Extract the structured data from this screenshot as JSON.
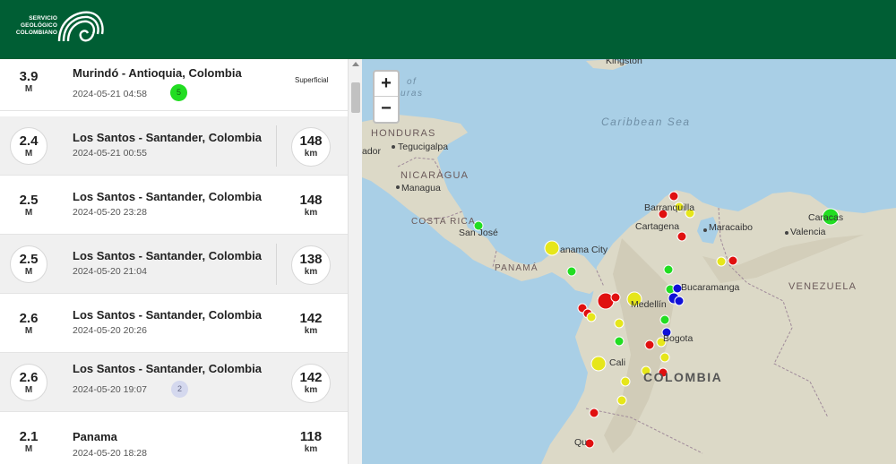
{
  "header": {
    "logo_lines": [
      "SERVICIO",
      "GEOLÓGICO",
      "COLOMBIANO"
    ],
    "brand_color": "#005e34"
  },
  "events": [
    {
      "mag": "3.9",
      "mag_unit": "M",
      "place": "Murindó - Antioquia, Colombia",
      "time": "2024-05-21 04:58",
      "depth_label": "Superficial",
      "badge": "5",
      "badge_color": "green"
    },
    {
      "mag": "2.4",
      "mag_unit": "M",
      "place": "Los Santos - Santander, Colombia",
      "time": "2024-05-21 00:55",
      "depth": "148",
      "depth_unit": "km"
    },
    {
      "mag": "2.5",
      "mag_unit": "M",
      "place": "Los Santos - Santander, Colombia",
      "time": "2024-05-20 23:28",
      "depth": "148",
      "depth_unit": "km"
    },
    {
      "mag": "2.5",
      "mag_unit": "M",
      "place": "Los Santos - Santander, Colombia",
      "time": "2024-05-20 21:04",
      "depth": "138",
      "depth_unit": "km"
    },
    {
      "mag": "2.6",
      "mag_unit": "M",
      "place": "Los Santos - Santander, Colombia",
      "time": "2024-05-20 20:26",
      "depth": "142",
      "depth_unit": "km"
    },
    {
      "mag": "2.6",
      "mag_unit": "M",
      "place": "Los Santos - Santander, Colombia",
      "time": "2024-05-20 19:07",
      "depth": "142",
      "depth_unit": "km",
      "badge": "2",
      "badge_color": "grey"
    },
    {
      "mag": "2.1",
      "mag_unit": "M",
      "place": "Panama",
      "time": "2024-05-20 18:28",
      "depth": "118",
      "depth_unit": "km"
    }
  ],
  "map": {
    "zoom_in": "+",
    "zoom_out": "−",
    "labels": {
      "kingston": "Kingston",
      "caribbean": "Caribbean Sea",
      "of": "of",
      "uras": "uras",
      "honduras": "HONDURAS",
      "tegucigalpa": "Tegucigalpa",
      "ador": "ador",
      "nicaragua": "NICARAGUA",
      "managua": "Managua",
      "costa_rica": "COSTA RICA",
      "san_jose": "San José",
      "panama_city": "anama City",
      "panama": "PANAMÁ",
      "barranquilla": "Barranquilla",
      "cartagena": "Cartagena",
      "maracaibo": "Maracaibo",
      "caracas": "Caracas",
      "valencia": "Valencia",
      "bucaramanga": "Bucaramanga",
      "venezuela": "VENEZUELA",
      "medellin": "Medellín",
      "bogota": "Bogota",
      "cali": "Cali",
      "colombia": "COLOMBIA",
      "quito": "Qu"
    },
    "marker_colors": {
      "red": "#e01010",
      "yellow": "#e6e61a",
      "green": "#22dd22",
      "blue": "#1010d8"
    }
  }
}
